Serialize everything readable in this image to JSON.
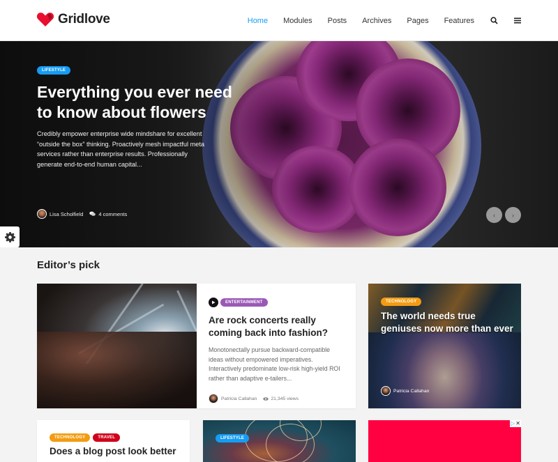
{
  "header": {
    "logo_text": "Gridlove",
    "brand_color": "#e8102e",
    "nav": [
      {
        "label": "Home",
        "active": true
      },
      {
        "label": "Modules",
        "active": false
      },
      {
        "label": "Posts",
        "active": false
      },
      {
        "label": "Archives",
        "active": false
      },
      {
        "label": "Pages",
        "active": false
      },
      {
        "label": "Features",
        "active": false
      }
    ],
    "icons": [
      "search-icon",
      "menu-icon"
    ],
    "accent_color": "#169cf3"
  },
  "hero": {
    "category": "Lifestyle",
    "title": "Everything you ever need to know about flowers",
    "excerpt": "Credibly empower enterprise wide mindshare for excellent “outside the box” thinking. Proactively mesh impactful meta services rather than enterprise results. Professionally generate end-to-end human capital...",
    "author": "Lisa Scholfield",
    "comments": "4 comments",
    "prev_label": "‹",
    "next_label": "›"
  },
  "settings": {
    "icon": "gear-icon"
  },
  "editors_pick": {
    "title": "Editor’s pick",
    "featured": {
      "category": "Entertainment",
      "category_color": "#9b59b6",
      "format_icon": "play-icon",
      "title": "Are rock concerts really coming back into fashion?",
      "excerpt": "Monotonectally pursue backward-compatible ideas without empowered imperatives. Interactively predominate low-risk high-yield ROI rather than adaptive e-tailers...",
      "author": "Patricia Callahan",
      "views": "21,345 views"
    },
    "side": {
      "category": "Technology",
      "category_color": "#f39c12",
      "title": "The world needs true geniuses now more than ever",
      "author": "Patricia Callahan"
    },
    "row2": {
      "card1": {
        "categories": [
          {
            "label": "Technology",
            "color": "#f39c12"
          },
          {
            "label": "Travel",
            "color": "#d0021b"
          }
        ],
        "title": "Does a blog post look better"
      },
      "card2": {
        "category": "Lifestyle",
        "category_color": "#169cf3"
      },
      "ad": {
        "color": "#ff0040",
        "info_icon": "ad-choices-icon",
        "close_icon": "close-icon"
      }
    }
  }
}
